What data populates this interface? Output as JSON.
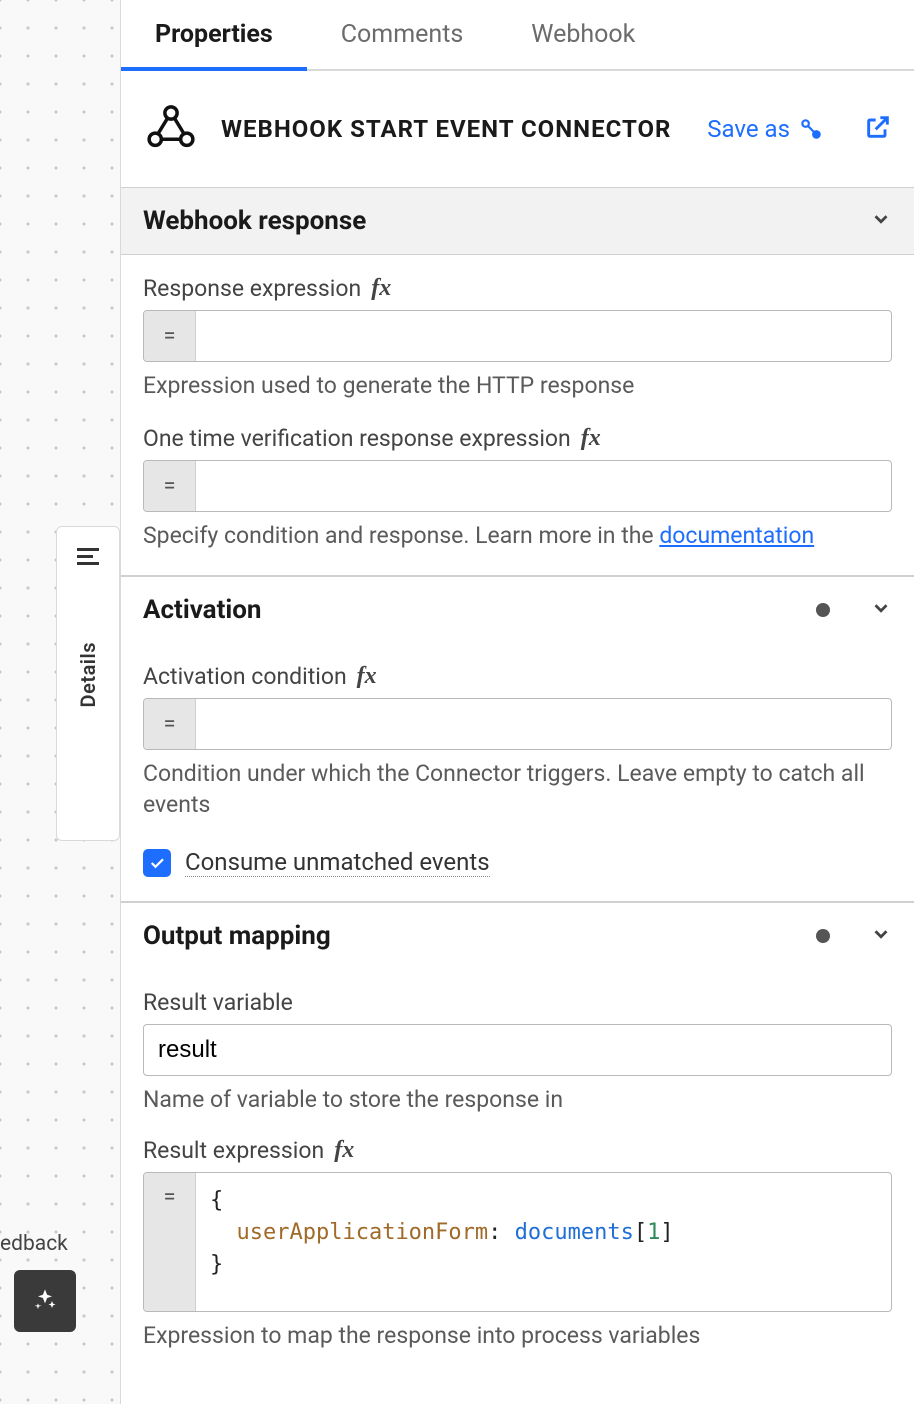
{
  "tabs": {
    "properties": "Properties",
    "comments": "Comments",
    "webhook": "Webhook"
  },
  "header": {
    "title": "WEBHOOK START EVENT CONNECTOR",
    "save_as": "Save as"
  },
  "side": {
    "details": "Details",
    "feedback": "edback"
  },
  "webhook_response": {
    "title": "Webhook response",
    "response_expression_label": "Response expression",
    "response_expression_value": "",
    "response_expression_help": "Expression used to generate the HTTP response",
    "onetime_label": "One time verification response expression",
    "onetime_value": "",
    "onetime_help_prefix": "Specify condition and response. Learn more in the ",
    "onetime_help_link": "documentation"
  },
  "activation": {
    "title": "Activation",
    "condition_label": "Activation condition",
    "condition_value": "",
    "condition_help": "Condition under which the Connector triggers. Leave empty to catch all events",
    "consume_label": "Consume unmatched events",
    "consume_checked": true
  },
  "output_mapping": {
    "title": "Output mapping",
    "result_variable_label": "Result variable",
    "result_variable_value": "result",
    "result_variable_help": "Name of variable to store the response in",
    "result_expression_label": "Result expression",
    "result_expression_code": {
      "key": "userApplicationForm",
      "var": "documents",
      "index": "1"
    },
    "result_expression_help": "Expression to map the response into process variables"
  }
}
